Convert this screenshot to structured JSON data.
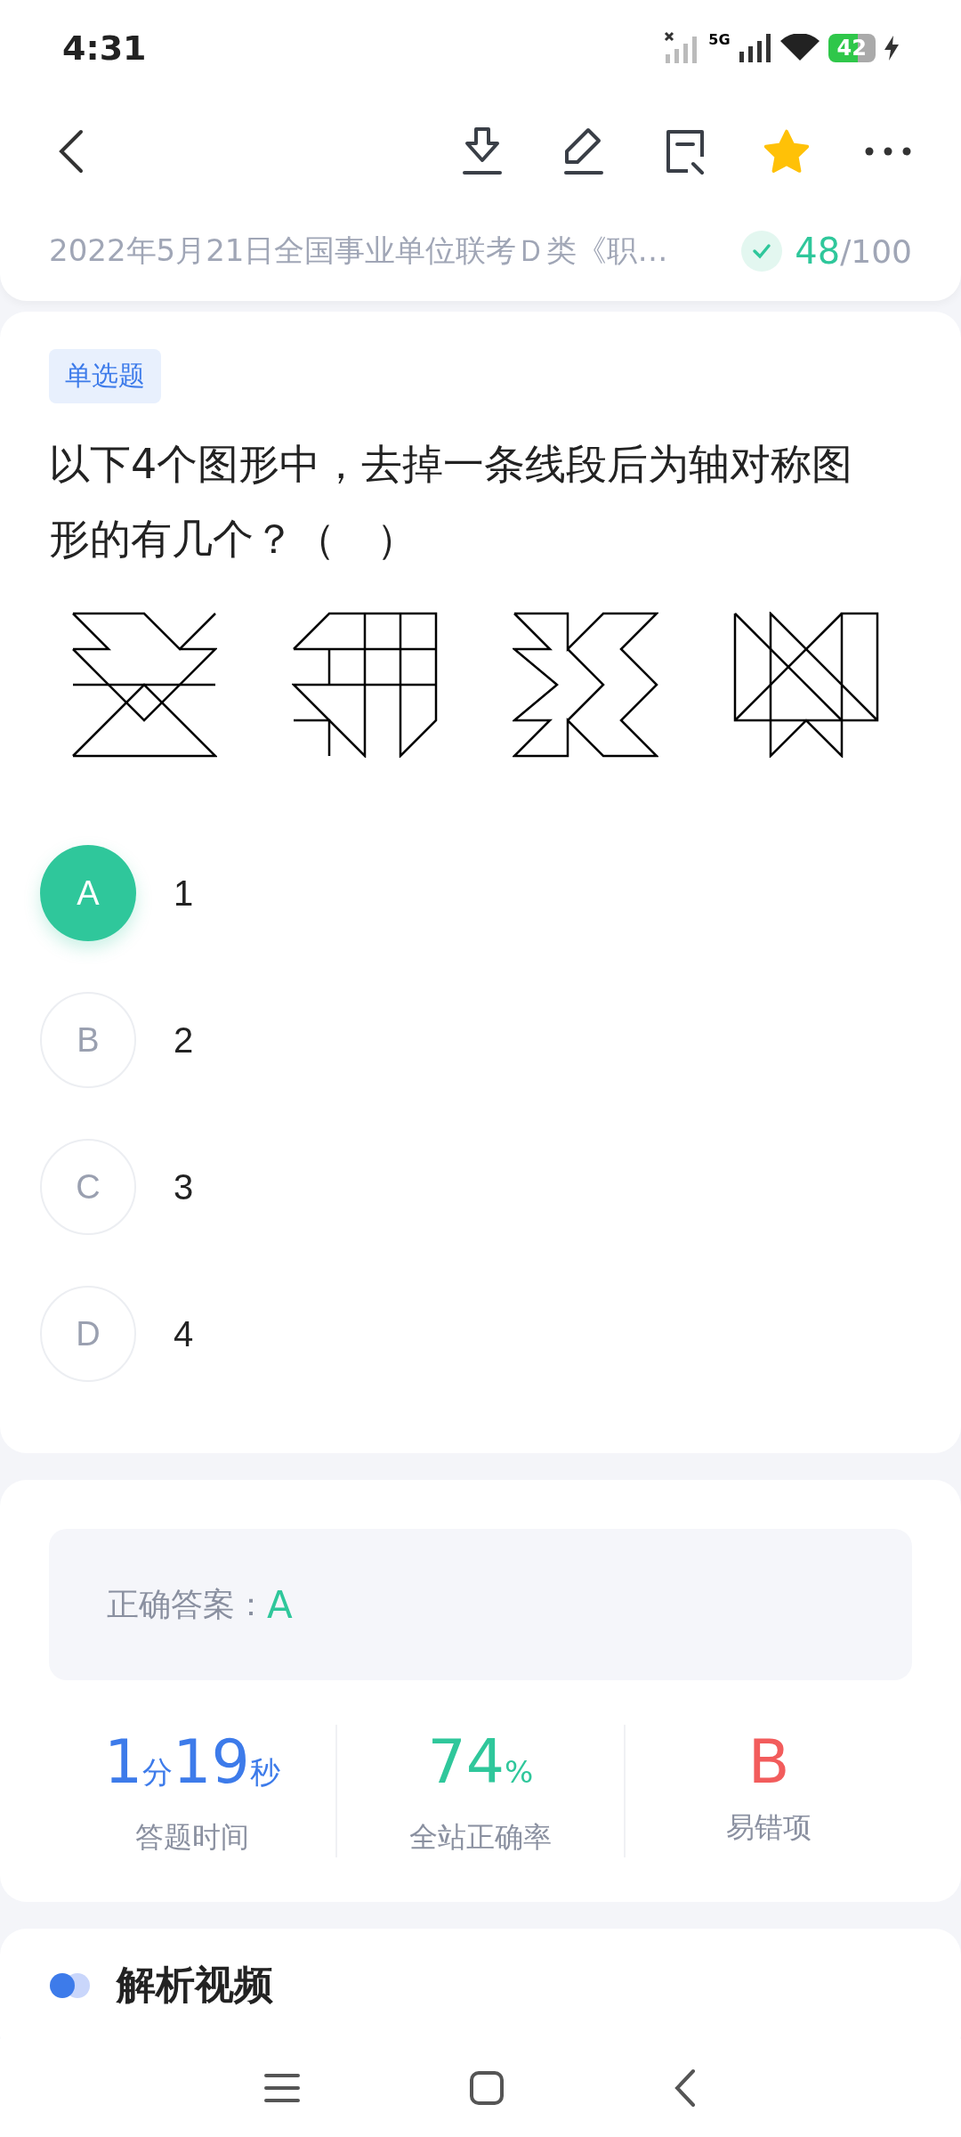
{
  "status_bar": {
    "time": "4:31",
    "network": "5G",
    "battery": "42"
  },
  "toolbar": {
    "starred": true
  },
  "paper": {
    "title": "2022年5月21日全国事业单位联考Ｄ类《职…",
    "done": true,
    "score": "48",
    "total": "/100"
  },
  "question": {
    "type_tag": "单选题",
    "text": "以下4个图形中，去掉一条线段后为轴对称图形的有几个？（　）"
  },
  "options": [
    {
      "letter": "A",
      "text": "1",
      "selected": true
    },
    {
      "letter": "B",
      "text": "2",
      "selected": false
    },
    {
      "letter": "C",
      "text": "3",
      "selected": false
    },
    {
      "letter": "D",
      "text": "4",
      "selected": false
    }
  ],
  "answer": {
    "label": "正确答案：",
    "value": "A"
  },
  "stats": [
    {
      "parts": [
        {
          "text": "1",
          "kind": "number"
        },
        {
          "text": "分",
          "kind": "unit"
        },
        {
          "text": "19",
          "kind": "number"
        },
        {
          "text": "秒",
          "kind": "unit"
        }
      ],
      "label": "答题时间",
      "color": "#3d7bea"
    },
    {
      "parts": [
        {
          "text": "74",
          "kind": "number"
        },
        {
          "text": "%",
          "kind": "unit"
        }
      ],
      "label": "全站正确率",
      "color": "#2fc79b"
    },
    {
      "parts": [
        {
          "text": "B",
          "kind": "number"
        }
      ],
      "label": "易错项",
      "color": "#f25c5c"
    }
  ],
  "video_section": {
    "title": "解析视频"
  }
}
